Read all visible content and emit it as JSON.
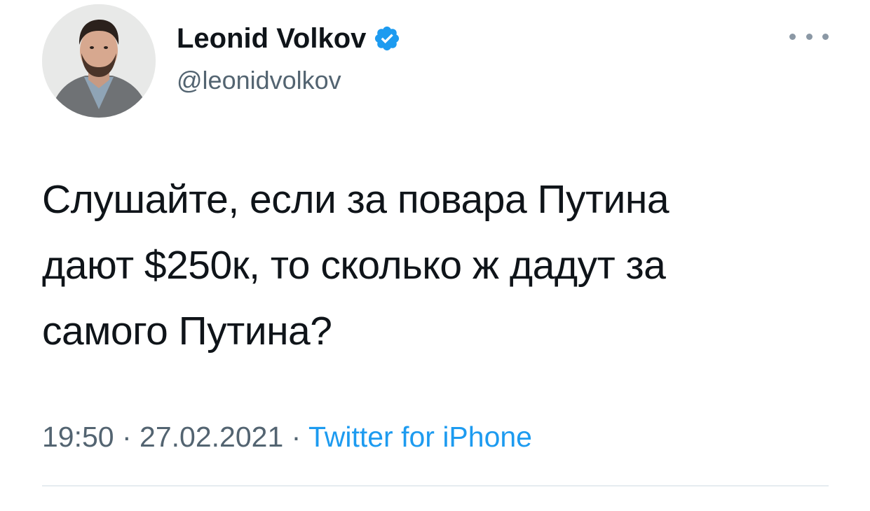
{
  "author": {
    "display_name": "Leonid Volkov",
    "handle": "@leonidvolkov",
    "verified": true,
    "avatar_icon": "profile-photo",
    "verified_icon": "verified-badge-icon",
    "verified_color": "#1d9bf0"
  },
  "menu": {
    "more_icon": "more-options-icon"
  },
  "tweet": {
    "text_lines": [
      "Слушайте, если за повара Путина",
      "дают $250к, то сколько ж дадут за",
      "самого Путина?"
    ],
    "time": "19:50",
    "separator": " · ",
    "date": "27.02.2021",
    "source": "Twitter for iPhone"
  },
  "colors": {
    "text_primary": "#0f1419",
    "text_secondary": "#536471",
    "link": "#1d9bf0",
    "divider": "#e6ecf0"
  }
}
